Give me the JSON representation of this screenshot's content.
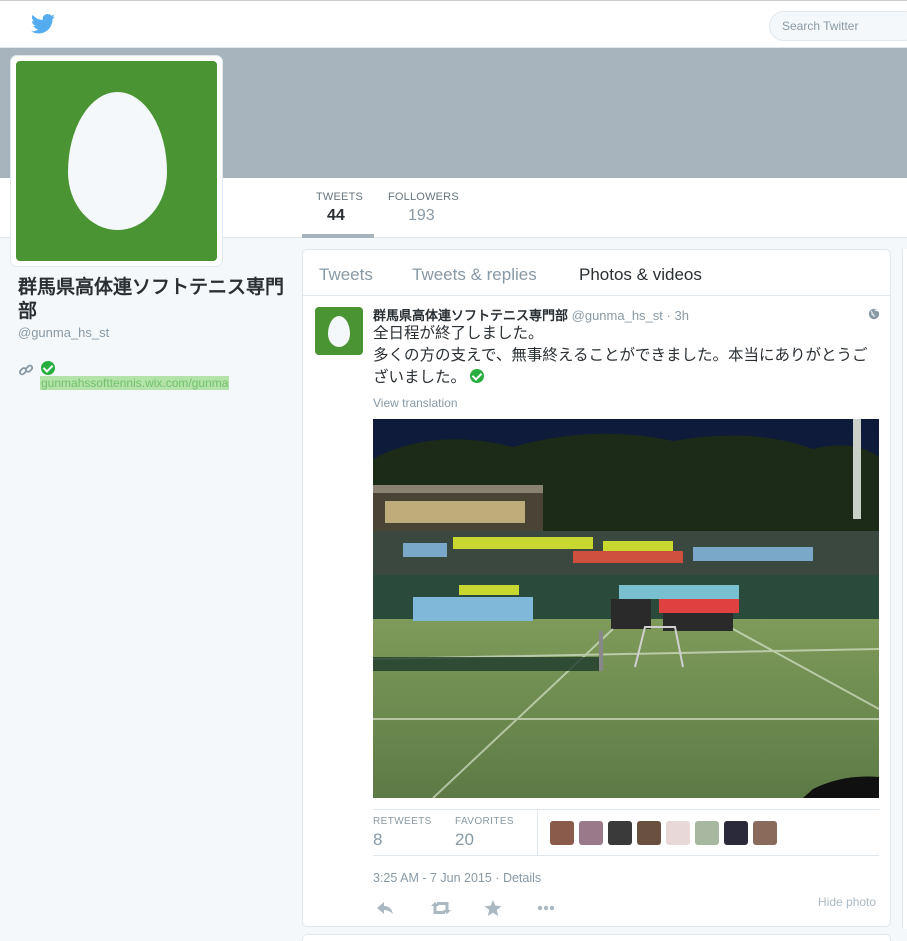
{
  "topbar": {
    "search_placeholder": "Search Twitter",
    "logo_icon": "twitter-bird-icon"
  },
  "profile": {
    "name": "群馬県高体連ソフトテニス専門部",
    "handle": "@gunma_hs_st",
    "url": "gunmahssofttennis.wix.com/gunma",
    "avatar_color": "#4b9433"
  },
  "stats": [
    {
      "label": "TWEETS",
      "value": "44"
    },
    {
      "label": "FOLLOWERS",
      "value": "193"
    }
  ],
  "tabs": [
    {
      "label": "Tweets",
      "active": false
    },
    {
      "label": "Tweets & replies",
      "active": false
    },
    {
      "label": "Photos & videos",
      "active": true
    }
  ],
  "tweet": {
    "name": "群馬県高体連ソフトテニス専門部",
    "handle": "@gunma_hs_st",
    "time": "3h",
    "text_line1": "全日程が終了しました。",
    "text_line2": "多くの方の支えで、無事終えることができました。本当にありがとうございました。",
    "view_translation": "View translation",
    "retweets_label": "RETWEETS",
    "retweets": "8",
    "favorites_label": "FAVORITES",
    "favorites": "20",
    "timestamp": "3:25 AM - 7 Jun 2015",
    "details": "Details",
    "hide_photo": "Hide photo",
    "favoriter_colors": [
      "#8a5a4a",
      "#9a7a8a",
      "#3a3a3a",
      "#6a5040",
      "#e8d8d8",
      "#a8b8a0",
      "#2a2a3a",
      "#8a6a5a"
    ]
  },
  "colors": {
    "accent": "#55acee",
    "banner": "#a8b4bd",
    "link_highlight": "#b3e3a9"
  }
}
